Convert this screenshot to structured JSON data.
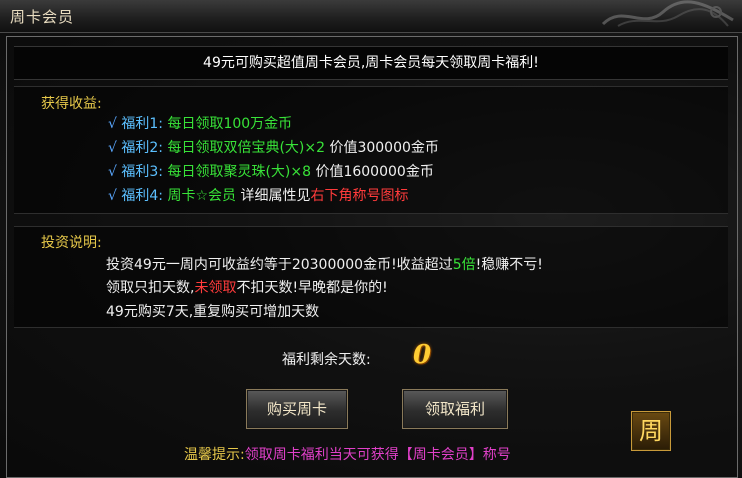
{
  "window": {
    "title": "周卡会员"
  },
  "headline": "49元可购买超值周卡会员,周卡会员每天领取周卡福利!",
  "benefits": {
    "title": "获得收益:",
    "check_mark": "√",
    "items": [
      {
        "label": "福利1:",
        "parts": [
          {
            "text": "每日领取100万金币",
            "color": "green"
          }
        ]
      },
      {
        "label": "福利2:",
        "parts": [
          {
            "text": "每日领取双倍宝典(大)×2",
            "color": "green"
          },
          {
            "text": " 价值300000金币",
            "color": "white"
          }
        ]
      },
      {
        "label": "福利3:",
        "parts": [
          {
            "text": "每日领取聚灵珠(大)×8",
            "color": "green"
          },
          {
            "text": " 价值1600000金币",
            "color": "white"
          }
        ]
      },
      {
        "label": "福利4:",
        "parts": [
          {
            "text": "周卡☆会员",
            "color": "green"
          },
          {
            "text": " 详细属性见",
            "color": "white"
          },
          {
            "text": "右下角称号图标",
            "color": "red"
          }
        ]
      }
    ]
  },
  "investment": {
    "title": "投资说明:",
    "lines": [
      [
        {
          "text": "投资49元一周内可收益约等于20300000金币!收益超过",
          "color": "white"
        },
        {
          "text": "5倍",
          "color": "green"
        },
        {
          "text": "!稳赚不亏!",
          "color": "white"
        }
      ],
      [
        {
          "text": "领取只扣天数,",
          "color": "white"
        },
        {
          "text": "未领取",
          "color": "red"
        },
        {
          "text": "不扣天数!早晚都是你的!",
          "color": "white"
        }
      ],
      [
        {
          "text": "49元购买7天,重复购买可增加天数",
          "color": "white"
        }
      ]
    ]
  },
  "remaining": {
    "label": "福利剩余天数:",
    "value": "0"
  },
  "buttons": {
    "buy": "购买周卡",
    "claim": "领取福利"
  },
  "week_icon": {
    "glyph": "周",
    "icon": "week-title-icon"
  },
  "tip": {
    "key": "温馨提示:",
    "value": "领取周卡福利当天可获得【周卡会员】称号"
  },
  "colors": {
    "green": "#38e238",
    "white": "#f0f0f0",
    "red": "#ff3b3b",
    "gold": "#e6c84a",
    "magenta": "#e040c8"
  }
}
